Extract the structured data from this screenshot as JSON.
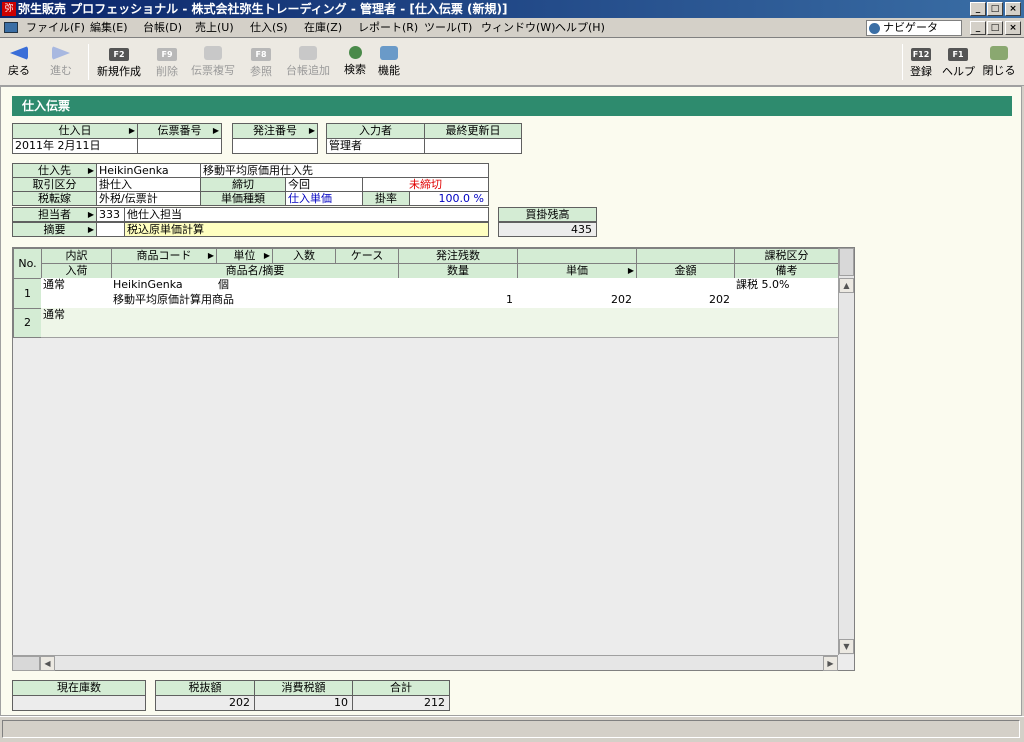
{
  "window": {
    "app_icon": "弥",
    "title": "弥生販売 プロフェッショナル - 株式会社弥生トレーディング - 管理者 - [仕入伝票 (新規)]",
    "min": "_",
    "max": "□",
    "close": "×"
  },
  "menu": {
    "items": [
      "ファイル(F)",
      "編集(E)",
      "台帳(D)",
      "売上(U)",
      "仕入(S)",
      "在庫(Z)",
      "レポート(R)",
      "ツール(T)",
      "ウィンドウ(W)",
      "ヘルプ(H)"
    ],
    "navigator": "ナビゲータ"
  },
  "toolbar": {
    "back": "戻る",
    "forward": "進む",
    "new": "新規作成",
    "new_key": "F2",
    "delete": "削除",
    "delete_key": "F9",
    "copy": "伝票複写",
    "reference": "参照",
    "reference_key": "F8",
    "ledger_add": "台帳追加",
    "search": "検索",
    "function": "機能",
    "register": "登録",
    "register_key": "F12",
    "help": "ヘルプ",
    "help_key": "F1",
    "close": "閉じる"
  },
  "form": {
    "title": "仕入伝票",
    "h1": {
      "date_label": "仕入日",
      "slip_label": "伝票番号",
      "order_label": "発注番号",
      "inputter_label": "入力者",
      "updated_label": "最終更新日",
      "date": "2011年 2月11日",
      "inputter": "管理者"
    },
    "h2": {
      "supplier_label": "仕入先",
      "supplier_code": "HeikinGenka",
      "supplier_name": "移動平均原価用仕入先",
      "trade_label": "取引区分",
      "trade": "掛仕入",
      "cutoff_label": "締切",
      "cutoff": "今回",
      "cutoff_status": "未締切",
      "tax_label": "税転嫁",
      "tax": "外税/伝票計",
      "price_type_label": "単価種類",
      "price_type": "仕入単価",
      "rate_label": "掛率",
      "rate": "100.0 %",
      "staff_label": "担当者",
      "staff_code": "333",
      "staff_name": "他仕入担当",
      "memo_label": "摘要",
      "memo": "税込原単価計算"
    },
    "payable_label": "買掛残高",
    "payable": "435"
  },
  "grid": {
    "headers_top": [
      "No.",
      "内訳",
      "商品コード",
      "単位",
      "入数",
      "ケース",
      "発注残数",
      "",
      "",
      "課税区分"
    ],
    "headers_bot": [
      "入荷",
      "商品名/摘要",
      "数量",
      "単価",
      "金額",
      "備考"
    ],
    "rows": [
      {
        "no": "1",
        "type": "通常",
        "code": "HeikinGenka",
        "unit": "個",
        "name": "移動平均原価計算用商品",
        "qty": "1",
        "price": "202",
        "amount": "202",
        "tax": "課税 5.0%"
      },
      {
        "no": "2",
        "type": "通常"
      }
    ]
  },
  "footer": {
    "stock_label": "現在庫数",
    "stock": "",
    "net_label": "税抜額",
    "tax_label": "消費税額",
    "total_label": "合計",
    "net": "202",
    "tax": "10",
    "total": "212"
  }
}
